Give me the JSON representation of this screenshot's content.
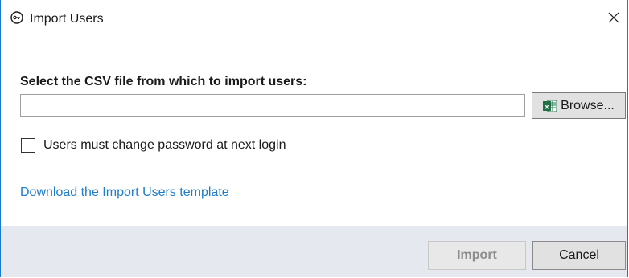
{
  "window": {
    "title": "Import Users",
    "icon": "key-circle-icon",
    "close_icon": "close-icon"
  },
  "form": {
    "prompt": "Select the CSV file from which to import users:",
    "file_input": {
      "value": "",
      "placeholder": ""
    },
    "browse_label": "Browse...",
    "browse_icon": "excel-icon",
    "checkbox_label": "Users must change password at next login",
    "checkbox_checked": false,
    "template_link": "Download the Import Users template"
  },
  "footer": {
    "import_label": "Import",
    "import_enabled": false,
    "cancel_label": "Cancel"
  },
  "colors": {
    "accent": "#1979ca",
    "link": "#1e7cc8",
    "footer_bg": "#e5e8ef",
    "excel_green": "#1e7145"
  }
}
